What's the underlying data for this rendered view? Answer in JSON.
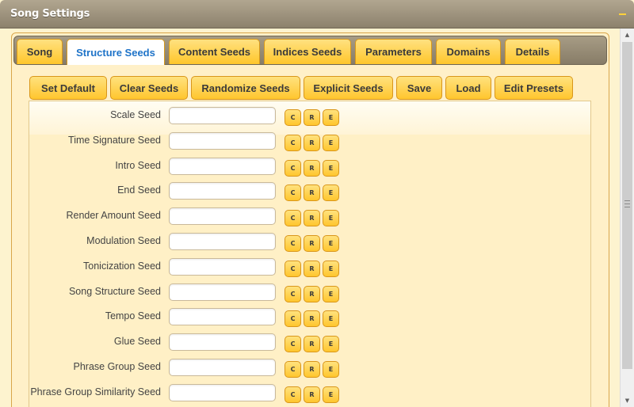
{
  "window": {
    "title": "Song Settings",
    "collapse_icon": "minus-icon",
    "accent_color": "#ffc62a"
  },
  "tabs": [
    {
      "label": "Song",
      "active": false
    },
    {
      "label": "Structure Seeds",
      "active": true
    },
    {
      "label": "Content Seeds",
      "active": false
    },
    {
      "label": "Indices Seeds",
      "active": false
    },
    {
      "label": "Parameters",
      "active": false
    },
    {
      "label": "Domains",
      "active": false
    },
    {
      "label": "Details",
      "active": false
    }
  ],
  "toolbar": {
    "set_default": "Set Default",
    "clear_seeds": "Clear Seeds",
    "randomize_seeds": "Randomize Seeds",
    "explicit_seeds": "Explicit Seeds",
    "save": "Save",
    "load": "Load",
    "edit_presets": "Edit Presets"
  },
  "seed_buttons": {
    "c": "C",
    "r": "R",
    "e": "E"
  },
  "seeds": [
    {
      "label": "Scale Seed",
      "value": ""
    },
    {
      "label": "Time Signature Seed",
      "value": ""
    },
    {
      "label": "Intro Seed",
      "value": ""
    },
    {
      "label": "End Seed",
      "value": ""
    },
    {
      "label": "Render Amount Seed",
      "value": ""
    },
    {
      "label": "Modulation Seed",
      "value": ""
    },
    {
      "label": "Tonicization Seed",
      "value": ""
    },
    {
      "label": "Song Structure Seed",
      "value": ""
    },
    {
      "label": "Tempo Seed",
      "value": ""
    },
    {
      "label": "Glue Seed",
      "value": ""
    },
    {
      "label": "Phrase Group Seed",
      "value": ""
    },
    {
      "label": "Phrase Group Similarity Seed",
      "value": ""
    }
  ]
}
